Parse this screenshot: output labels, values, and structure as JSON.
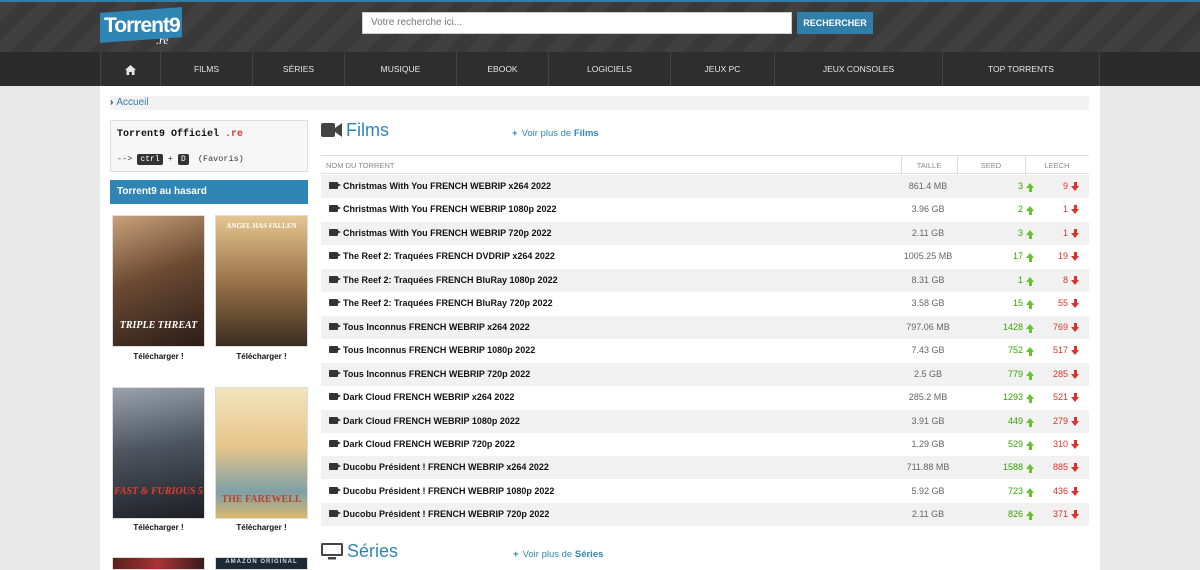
{
  "header": {
    "logo_text": "Torrent9",
    "logo_sub": ".re",
    "search_placeholder": "Votre recherche ici...",
    "search_button": "RECHERCHER"
  },
  "nav": {
    "home_icon": "home-icon",
    "items": [
      "FILMS",
      "SÉRIES",
      "MUSIQUE",
      "EBOOK",
      "LOGICIELS",
      "JEUX PC",
      "JEUX CONSOLES",
      "TOP TORRENTS"
    ]
  },
  "breadcrumb": {
    "label": "Accueil"
  },
  "sidebar": {
    "official_title": "Torrent9 Officiel",
    "official_suffix": ".re",
    "hint_prefix": "-->",
    "hint_key1": "ctrl",
    "hint_plus": "+",
    "hint_key2": "D",
    "hint_suffix": "(Favoris)",
    "random_title": "Torrent9 au hasard",
    "posters": [
      {
        "title": "TRIPLE THREAT",
        "caption": "Télécharger !",
        "color": "#5a3a2a"
      },
      {
        "title": "ANGEL HAS FALLEN",
        "caption": "Télécharger !",
        "color": "#8a6a40"
      },
      {
        "title": "FAST & FURIOUS 5",
        "caption": "Télécharger !",
        "color": "#4a4a55"
      },
      {
        "title": "THE FAREWELL",
        "caption": "Télécharger !",
        "color": "#e9c98a"
      },
      {
        "title": "",
        "caption": "",
        "color": "#3a3a3a"
      },
      {
        "title": "AMAZON ORIGINAL",
        "caption": "",
        "color": "#1d2a35"
      }
    ]
  },
  "films": {
    "title": "Films",
    "more_prefix": "Voir plus de",
    "more_target": "Films",
    "columns": {
      "name": "NOM DU TORRENT",
      "size": "TAILLE",
      "seed": "SEED",
      "leech": "LEECH"
    },
    "rows": [
      {
        "name": "Christmas With You FRENCH WEBRIP x264 2022",
        "size": "861.4 MB",
        "seed": "3",
        "leech": "9"
      },
      {
        "name": "Christmas With You FRENCH WEBRIP 1080p 2022",
        "size": "3.96 GB",
        "seed": "2",
        "leech": "1"
      },
      {
        "name": "Christmas With You FRENCH WEBRIP 720p 2022",
        "size": "2.11 GB",
        "seed": "3",
        "leech": "1"
      },
      {
        "name": "The Reef 2: Traquées FRENCH DVDRIP x264 2022",
        "size": "1005.25 MB",
        "seed": "17",
        "leech": "19"
      },
      {
        "name": "The Reef 2: Traquées FRENCH BluRay 1080p 2022",
        "size": "8.31 GB",
        "seed": "1",
        "leech": "8"
      },
      {
        "name": "The Reef 2: Traquées FRENCH BluRay 720p 2022",
        "size": "3.58 GB",
        "seed": "15",
        "leech": "55"
      },
      {
        "name": "Tous Inconnus FRENCH WEBRIP x264 2022",
        "size": "797.06 MB",
        "seed": "1428",
        "leech": "769"
      },
      {
        "name": "Tous Inconnus FRENCH WEBRIP 1080p 2022",
        "size": "7.43 GB",
        "seed": "752",
        "leech": "517"
      },
      {
        "name": "Tous Inconnus FRENCH WEBRIP 720p 2022",
        "size": "2.5 GB",
        "seed": "779",
        "leech": "285"
      },
      {
        "name": "Dark Cloud FRENCH WEBRIP x264 2022",
        "size": "285.2 MB",
        "seed": "1293",
        "leech": "521"
      },
      {
        "name": "Dark Cloud FRENCH WEBRIP 1080p 2022",
        "size": "3.91 GB",
        "seed": "449",
        "leech": "279"
      },
      {
        "name": "Dark Cloud FRENCH WEBRIP 720p 2022",
        "size": "1.29 GB",
        "seed": "529",
        "leech": "310"
      },
      {
        "name": "Ducobu Président ! FRENCH WEBRIP x264 2022",
        "size": "711.88 MB",
        "seed": "1588",
        "leech": "885"
      },
      {
        "name": "Ducobu Président ! FRENCH WEBRIP 1080p 2022",
        "size": "5.92 GB",
        "seed": "723",
        "leech": "436"
      },
      {
        "name": "Ducobu Président ! FRENCH WEBRIP 720p 2022",
        "size": "2.11 GB",
        "seed": "826",
        "leech": "371"
      }
    ]
  },
  "series": {
    "title": "Séries",
    "more_prefix": "Voir plus de",
    "more_target": "Séries"
  }
}
